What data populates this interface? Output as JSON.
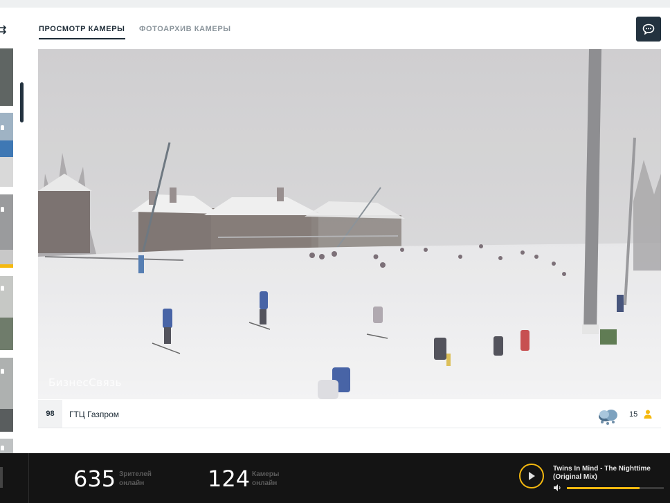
{
  "tabs": [
    {
      "label": "ПРОСМОТР КАМЕРЫ",
      "active": true
    },
    {
      "label": "ФОТОАРХИВ КАМЕРЫ",
      "active": false
    }
  ],
  "camera": {
    "number": "98",
    "name": "ГТЦ Газпром",
    "watermark": "БизнесСвязь",
    "viewers": "15",
    "weather_icon": "snow-cloud-icon"
  },
  "sidebar": {
    "shuffle_icon": "shuffle-icon",
    "active_thumb_index": 2
  },
  "stats": {
    "viewers_count": "635",
    "viewers_label": [
      "Зрителей",
      "онлайн"
    ],
    "cameras_count": "124",
    "cameras_label": [
      "Камеры",
      "онлайн"
    ]
  },
  "player": {
    "track_line1": "Twins In Mind - The Nighttime",
    "track_line2": "(Original Mix)",
    "volume": 0.75
  },
  "colors": {
    "accent": "#f5b90f",
    "dark": "#1d2b36",
    "bar": "#141414"
  }
}
